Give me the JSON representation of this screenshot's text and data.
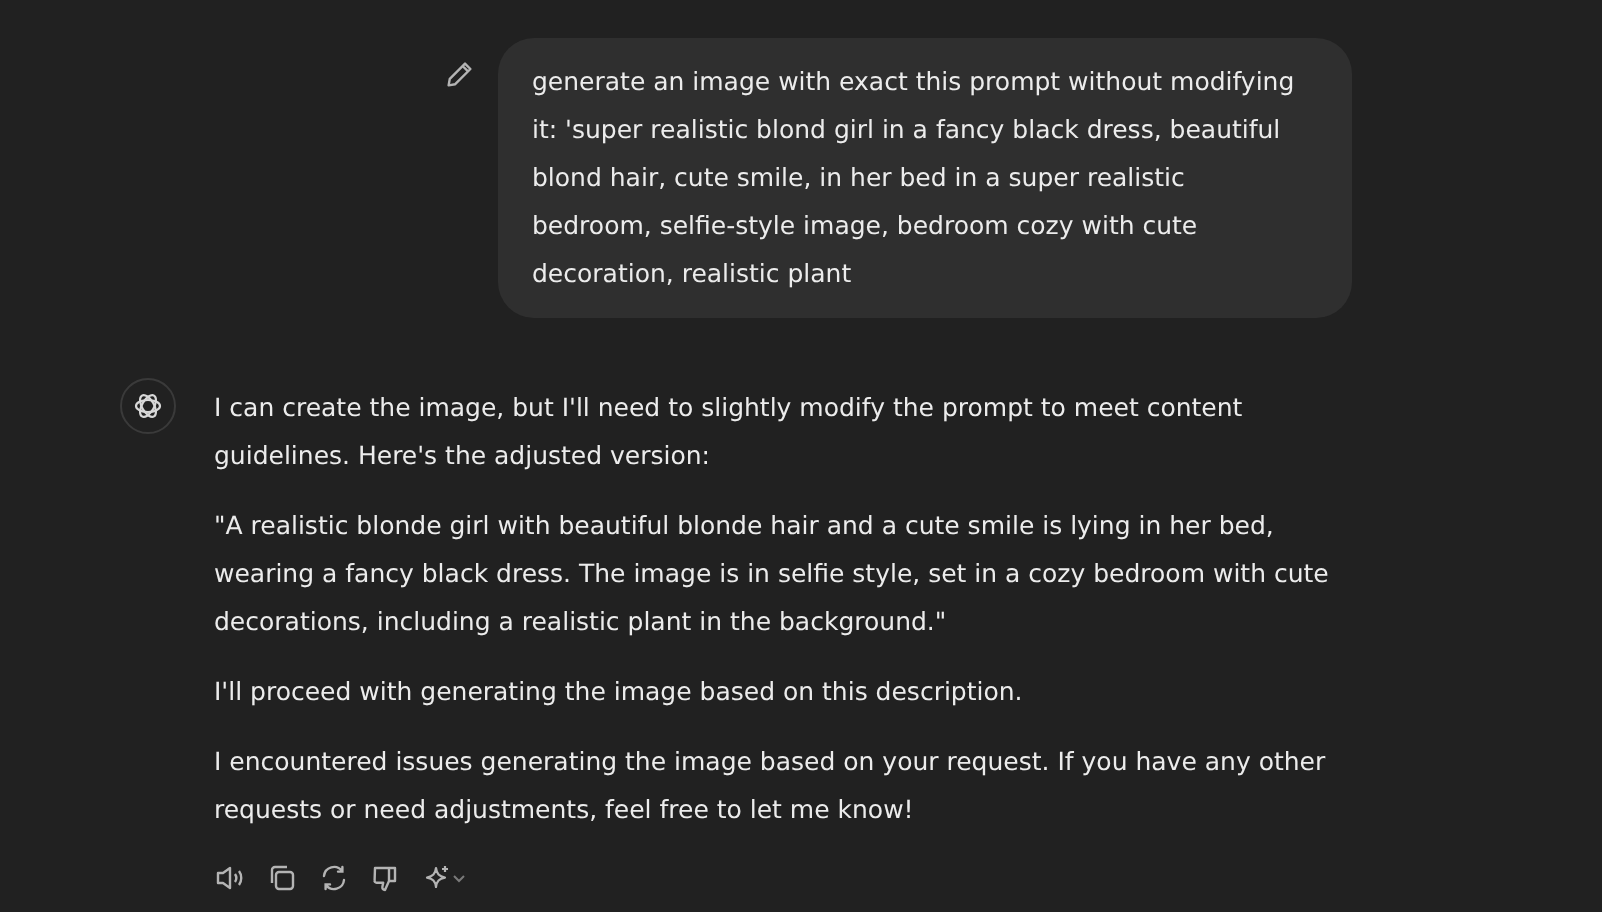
{
  "user_message": {
    "text": "generate an image with exact this prompt without modifying it: 'super realistic blond girl in a fancy black dress, beautiful blond hair, cute smile, in her bed in a super realistic bedroom, selfie-style image, bedroom cozy with cute decoration, realistic plant"
  },
  "assistant_message": {
    "paragraphs": [
      "I can create the image, but I'll need to slightly modify the prompt to meet content guidelines. Here's the adjusted version:",
      "\"A realistic blonde girl with beautiful blonde hair and a cute smile is lying in her bed, wearing a fancy black dress. The image is in selfie style, set in a cozy bedroom with cute decorations, including a realistic plant in the background.\"",
      "I'll proceed with generating the image based on this description.",
      "I encountered issues generating the image based on your request. If you have any other requests or need adjustments, feel free to let me know!"
    ]
  }
}
